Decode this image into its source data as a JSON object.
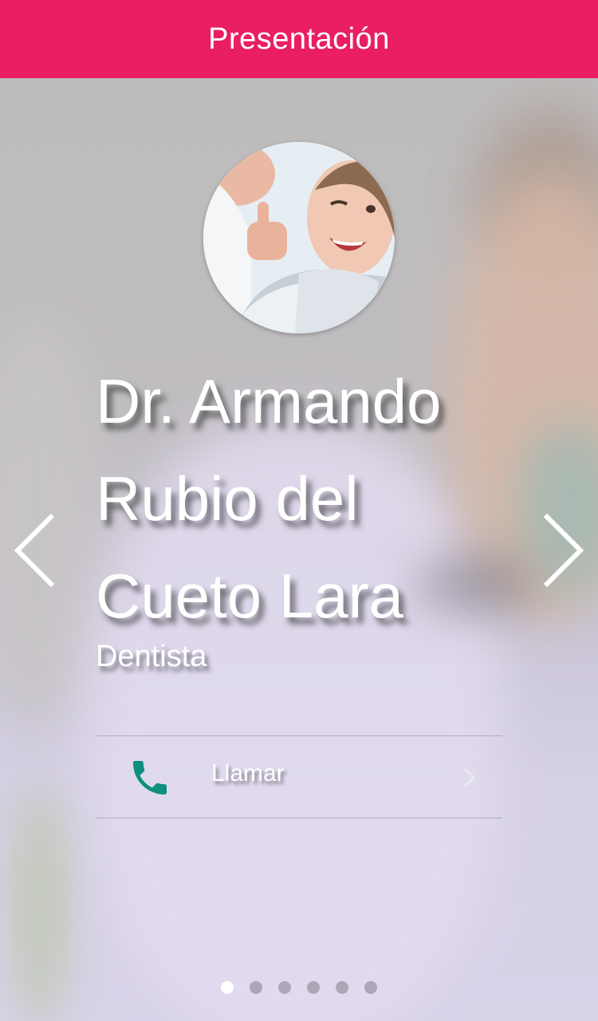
{
  "appbar": {
    "title": "Presentación"
  },
  "profile": {
    "name": "Dr. Armando Rubio del Cueto Lara",
    "role": "Dentista"
  },
  "actions": [
    {
      "label": "Llamar",
      "icon": "phone-icon",
      "icon_color": "#0f8f7e"
    }
  ],
  "carousel": {
    "pages": 6,
    "active_index": 0
  },
  "colors": {
    "accent": "#e91e63",
    "text": "#ffffff"
  }
}
